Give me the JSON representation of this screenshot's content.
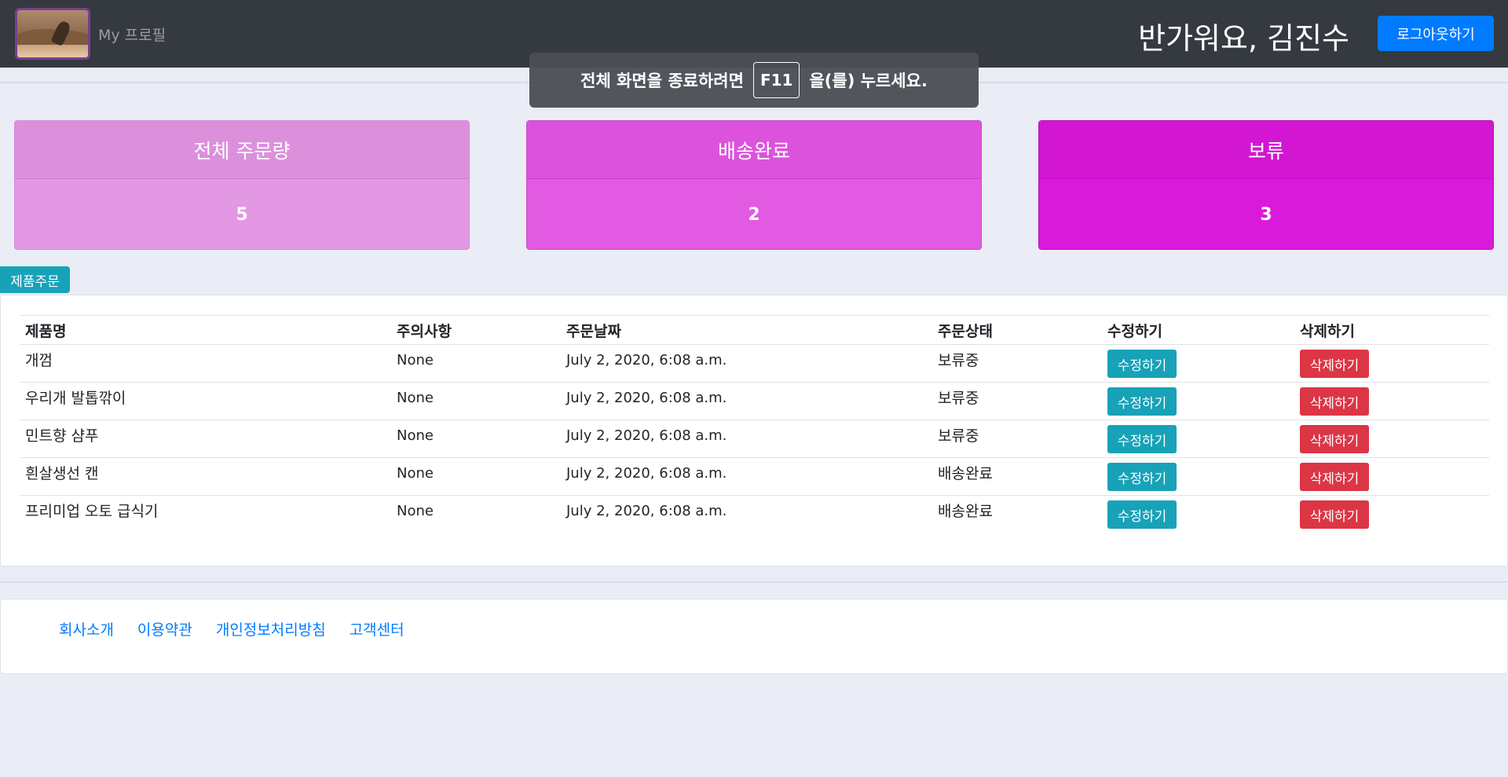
{
  "header": {
    "profile_label": "My 프로필",
    "greeting": "반가워요, 김진수",
    "logout_label": "로그아웃하기"
  },
  "fullscreen_notice": {
    "before": "전체 화면을 종료하려면",
    "key": "F11",
    "after": "을(를) 누르세요."
  },
  "stats": [
    {
      "title": "전체 주문량",
      "value": "5",
      "color": "#dc90dc"
    },
    {
      "title": "배송완료",
      "value": "2",
      "color": "#dc52dc"
    },
    {
      "title": "보류",
      "value": "3",
      "color": "#d216d2"
    }
  ],
  "order_button_label": "제품주문",
  "table": {
    "headers": [
      "제품명",
      "주의사항",
      "주문날짜",
      "주문상태",
      "수정하기",
      "삭제하기"
    ],
    "edit_label": "수정하기",
    "delete_label": "삭제하기",
    "rows": [
      {
        "name": "개껌",
        "note": "None",
        "date": "July 2, 2020, 6:08 a.m.",
        "status": "보류중"
      },
      {
        "name": "우리개 발톱깎이",
        "note": "None",
        "date": "July 2, 2020, 6:08 a.m.",
        "status": "보류중"
      },
      {
        "name": "민트향 샴푸",
        "note": "None",
        "date": "July 2, 2020, 6:08 a.m.",
        "status": "보류중"
      },
      {
        "name": "흰살생선 캔",
        "note": "None",
        "date": "July 2, 2020, 6:08 a.m.",
        "status": "배송완료"
      },
      {
        "name": "프리미업 오토 급식기",
        "note": "None",
        "date": "July 2, 2020, 6:08 a.m.",
        "status": "배송완료"
      }
    ]
  },
  "footer": {
    "links": [
      "회사소개",
      "이용약관",
      "개인정보처리방침",
      "고객센터"
    ]
  },
  "colors": {
    "navbar": "#343a40",
    "primary": "#007bff",
    "info": "#17a2b8",
    "danger": "#dc3545",
    "background": "#eaedf5"
  }
}
